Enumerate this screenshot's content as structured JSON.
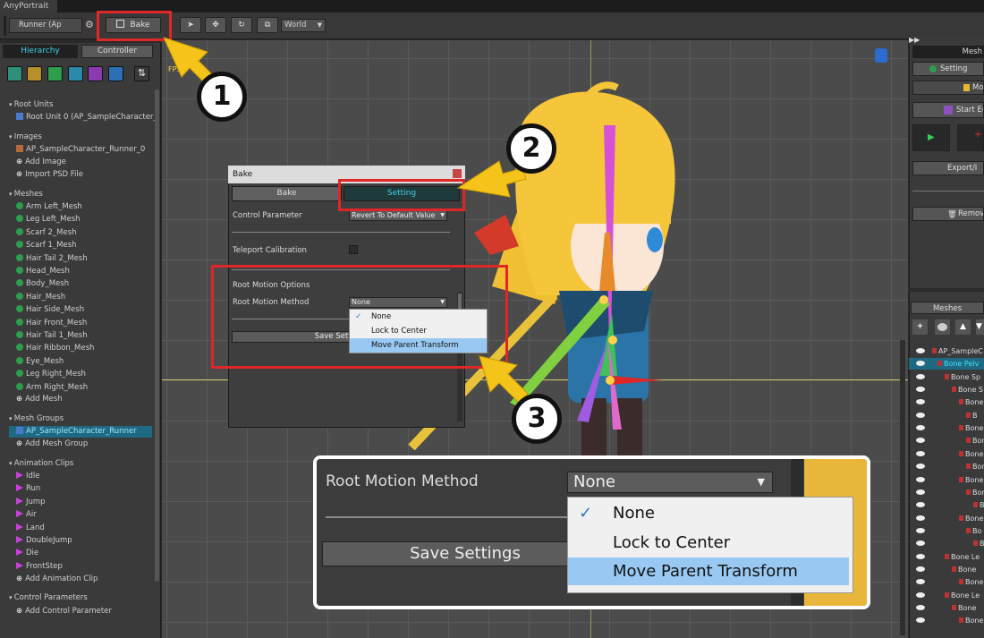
{
  "app": {
    "title": "AnyPortrait"
  },
  "toolbar": {
    "scene": "Runner (Ap",
    "bake_label": "Bake",
    "space": "World"
  },
  "left": {
    "tabs": [
      "Hierarchy",
      "Controller"
    ],
    "root_units": {
      "title": "Root Units",
      "items": [
        "Root Unit 0 (AP_SampleCharacter_"
      ]
    },
    "images": {
      "title": "Images",
      "items": [
        "AP_SampleCharacter_Runner_0"
      ],
      "add": "Add Image",
      "import": "Import PSD File"
    },
    "meshes": {
      "title": "Meshes",
      "items": [
        "Arm Left_Mesh",
        "Leg Left_Mesh",
        "Scarf 2_Mesh",
        "Scarf 1_Mesh",
        "Hair Tail 2_Mesh",
        "Head_Mesh",
        "Body_Mesh",
        "Hair_Mesh",
        "Hair Side_Mesh",
        "Hair Front_Mesh",
        "Hair Tail 1_Mesh",
        "Hair Ribbon_Mesh",
        "Eye_Mesh",
        "Leg Right_Mesh",
        "Arm Right_Mesh"
      ],
      "add": "Add Mesh"
    },
    "mesh_groups": {
      "title": "Mesh Groups",
      "items": [
        "AP_SampleCharacter_Runner"
      ],
      "add": "Add Mesh Group"
    },
    "animation_clips": {
      "title": "Animation Clips",
      "items": [
        "Idle",
        "Run",
        "Jump",
        "Air",
        "Land",
        "DoubleJump",
        "Die",
        "FrontStep"
      ],
      "add": "Add Animation Clip"
    },
    "control_params": {
      "title": "Control Parameters",
      "add": "Add Control Parameter"
    }
  },
  "viewport": {
    "fps": "FPS"
  },
  "right": {
    "tab": "Mesh",
    "buttons": [
      "Setting",
      "Mo",
      "Start Ed",
      "Export/I",
      "Remov"
    ],
    "meshes_tab": "Meshes",
    "tree": [
      "AP_SampleC",
      "Bone Pelv",
      "Bone Sp",
      "Bone S",
      "Bone",
      "B",
      "Bone",
      "Bon",
      "Bone",
      "Bon",
      "Bone",
      "Bone",
      "B",
      "Bone",
      "Bo",
      "B",
      "Bone Le",
      "Bone",
      "Bone",
      "Bone Le",
      "Bone",
      "Bone"
    ]
  },
  "bake": {
    "title": "Bake",
    "tabs": [
      "Bake",
      "Setting"
    ],
    "control_parameter_label": "Control Parameter",
    "control_parameter_value": "Revert To Default Value",
    "teleport_label": "Teleport Calibration",
    "root_motion_header": "Root Motion Options",
    "root_motion_label": "Root Motion Method",
    "root_motion_value": "None",
    "save_label": "Save Settings",
    "options": [
      "None",
      "Lock to Center",
      "Move Parent Transform"
    ]
  },
  "zoom": {
    "label": "Root Motion Method",
    "value": "None",
    "save": "Save Settings",
    "options": [
      "None",
      "Lock to Center",
      "Move Parent Transform"
    ]
  },
  "callouts": [
    "1",
    "2",
    "3"
  ],
  "colors": {
    "highlight": "#e02626",
    "arrow": "#f5c41a",
    "selected": "#1f6a82",
    "dropdown_selected": "#99c9f2",
    "check": "#2b76c8"
  }
}
